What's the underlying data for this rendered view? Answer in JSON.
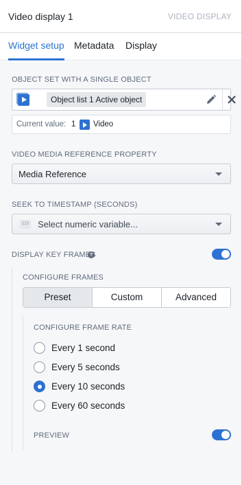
{
  "header": {
    "title": "Video display 1",
    "widget_type": "VIDEO DISPLAY"
  },
  "tabs": [
    {
      "label": "Widget setup",
      "active": true
    },
    {
      "label": "Metadata",
      "active": false
    },
    {
      "label": "Display",
      "active": false
    }
  ],
  "object_set": {
    "section_label": "OBJECT SET WITH A SINGLE OBJECT",
    "tag": "Object list 1 Active object",
    "icon": "object-set-icon",
    "current_value_label": "Current value:",
    "current_value_count": "1",
    "current_value_text": "Video"
  },
  "media_property": {
    "section_label": "VIDEO MEDIA REFERENCE PROPERTY",
    "value": "Media Reference"
  },
  "seek": {
    "section_label": "SEEK TO TIMESTAMP (SECONDS)",
    "icon_text": "123",
    "placeholder": "Select numeric variable..."
  },
  "key_frames": {
    "label": "DISPLAY KEY FRAMES",
    "enabled": true,
    "configure_label": "CONFIGURE FRAMES",
    "modes": [
      {
        "label": "Preset",
        "active": true
      },
      {
        "label": "Custom",
        "active": false
      },
      {
        "label": "Advanced",
        "active": false
      }
    ],
    "rate_label": "CONFIGURE FRAME RATE",
    "rates": [
      {
        "label": "Every 1 second",
        "checked": false
      },
      {
        "label": "Every 5 seconds",
        "checked": false
      },
      {
        "label": "Every 10 seconds",
        "checked": true
      },
      {
        "label": "Every 60 seconds",
        "checked": false
      }
    ],
    "preview_label": "PREVIEW",
    "preview_enabled": true
  },
  "colors": {
    "accent": "#2d72d2",
    "muted_text": "#5f6b7c",
    "border": "#c5cbd3"
  }
}
